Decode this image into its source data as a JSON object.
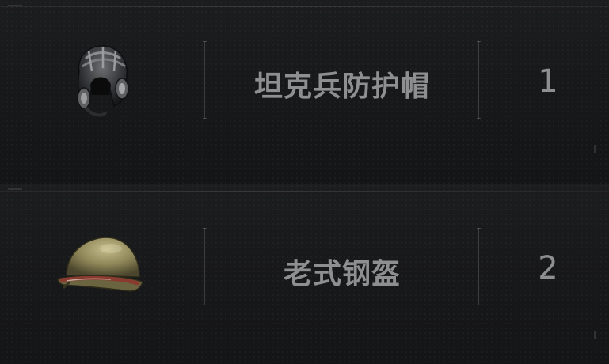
{
  "items": [
    {
      "icon": "tanker-helmet-icon",
      "name": "坦克兵防护帽",
      "count": "1"
    },
    {
      "icon": "steel-helmet-icon",
      "name": "老式钢盔",
      "count": "2"
    }
  ]
}
